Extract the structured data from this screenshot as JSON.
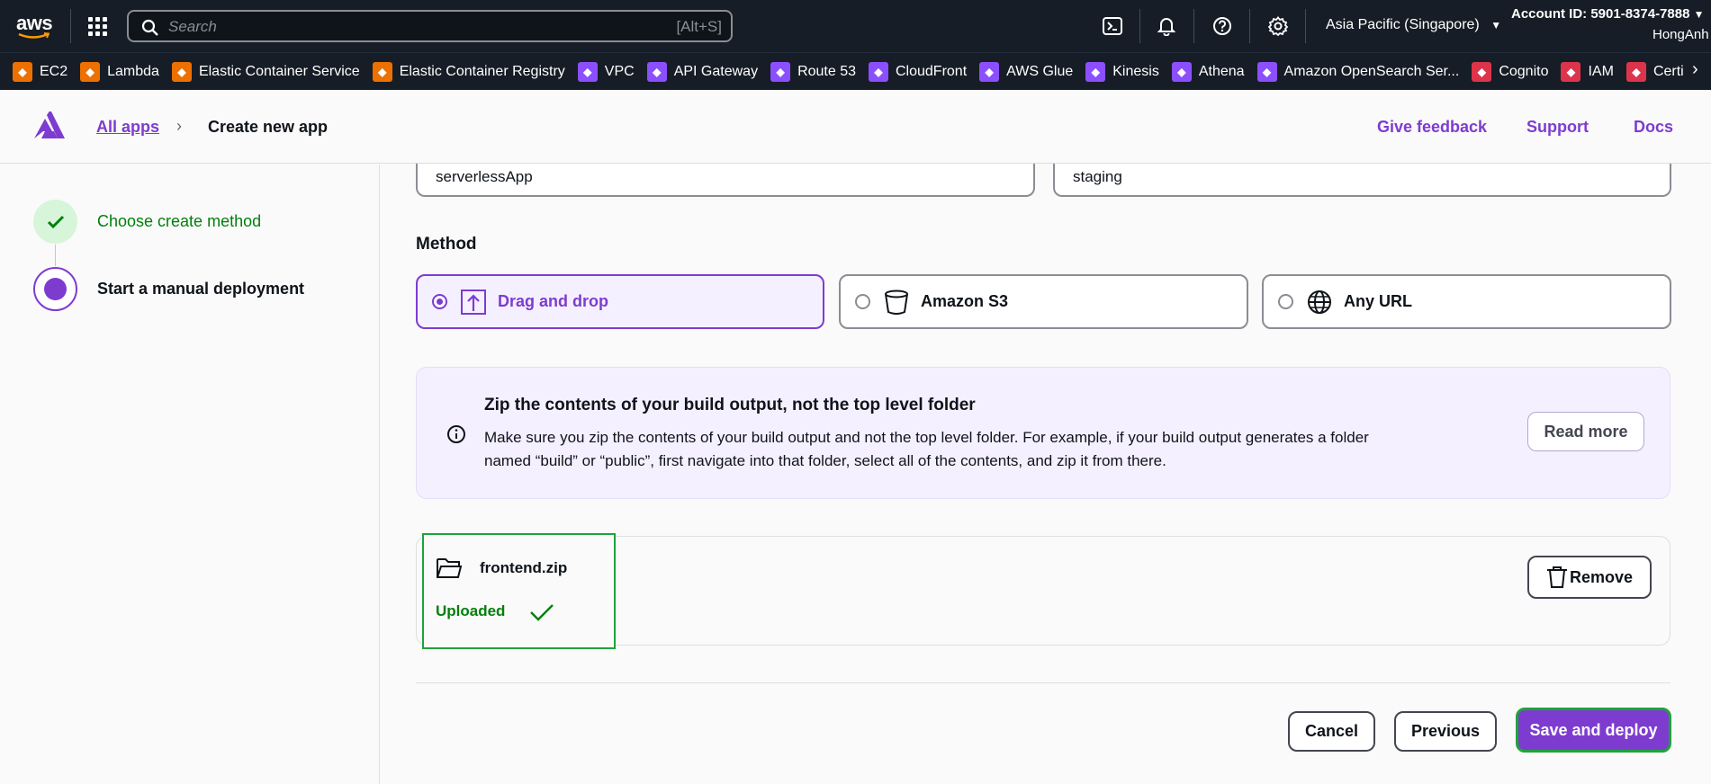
{
  "topnav": {
    "logo": "aws",
    "search_placeholder": "Search",
    "search_shortcut": "[Alt+S]",
    "region": "Asia Pacific (Singapore)",
    "account": "Account ID: 5901-8374-7888",
    "user": "HongAnh"
  },
  "favorites": [
    {
      "label": "EC2",
      "color": "#ed7100",
      "icon": "ec2-icon"
    },
    {
      "label": "Lambda",
      "color": "#ed7100",
      "icon": "lambda-icon"
    },
    {
      "label": "Elastic Container Service",
      "color": "#ed7100",
      "icon": "ecs-icon"
    },
    {
      "label": "Elastic Container Registry",
      "color": "#ed7100",
      "icon": "ecr-icon"
    },
    {
      "label": "VPC",
      "color": "#8c4fff",
      "icon": "vpc-icon"
    },
    {
      "label": "API Gateway",
      "color": "#8c4fff",
      "icon": "api-gateway-icon"
    },
    {
      "label": "Route 53",
      "color": "#8c4fff",
      "icon": "route53-icon"
    },
    {
      "label": "CloudFront",
      "color": "#8c4fff",
      "icon": "cloudfront-icon"
    },
    {
      "label": "AWS Glue",
      "color": "#8c4fff",
      "icon": "glue-icon"
    },
    {
      "label": "Kinesis",
      "color": "#8c4fff",
      "icon": "kinesis-icon"
    },
    {
      "label": "Athena",
      "color": "#8c4fff",
      "icon": "athena-icon"
    },
    {
      "label": "Amazon OpenSearch Ser...",
      "color": "#8c4fff",
      "icon": "opensearch-icon"
    },
    {
      "label": "Cognito",
      "color": "#dd344c",
      "icon": "cognito-icon"
    },
    {
      "label": "IAM",
      "color": "#dd344c",
      "icon": "iam-icon"
    },
    {
      "label": "Certi",
      "color": "#dd344c",
      "icon": "certificate-manager-icon"
    }
  ],
  "header": {
    "breadcrumb_link": "All apps",
    "breadcrumb_current": "Create new app",
    "give_feedback": "Give feedback",
    "support": "Support",
    "docs": "Docs"
  },
  "steps": [
    {
      "label": "Choose create method",
      "state": "complete"
    },
    {
      "label": "Start a manual deployment",
      "state": "current"
    }
  ],
  "form": {
    "app_name_value": "serverlessApp",
    "branch_name_value": "staging",
    "method_title": "Method",
    "methods": [
      {
        "label": "Drag and drop",
        "selected": true,
        "icon": "upload-icon"
      },
      {
        "label": "Amazon S3",
        "selected": false,
        "icon": "bucket-icon"
      },
      {
        "label": "Any URL",
        "selected": false,
        "icon": "globe-icon"
      }
    ]
  },
  "alert": {
    "title": "Zip the contents of your build output, not the top level folder",
    "body": "Make sure you zip the contents of your build output and not the top level folder. For example, if your build output generates a folder named “build” or “public”, first navigate into that folder, select all of the contents, and zip it from there.",
    "action": "Read more"
  },
  "file": {
    "name": "frontend.zip",
    "status": "Uploaded",
    "remove_label": "Remove"
  },
  "footer": {
    "cancel": "Cancel",
    "previous": "Previous",
    "save_deploy": "Save and deploy"
  },
  "colors": {
    "accent": "#7d3ccf",
    "success": "#037f0c",
    "nav_bg": "#161d26"
  }
}
